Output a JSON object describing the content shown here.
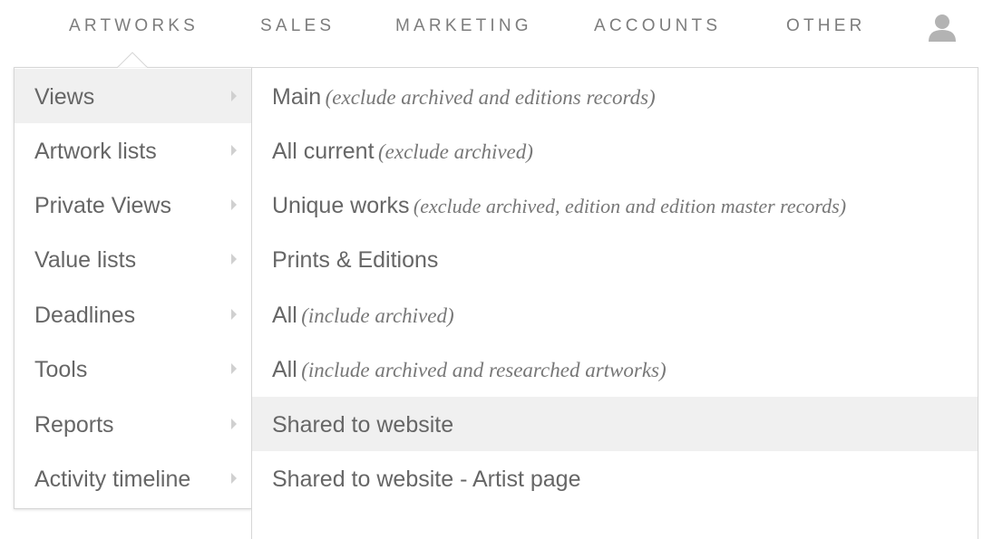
{
  "nav": {
    "items": [
      {
        "label": "ARTWORKS",
        "id": "artworks"
      },
      {
        "label": "SALES",
        "id": "sales"
      },
      {
        "label": "MARKETING",
        "id": "marketing"
      },
      {
        "label": "ACCOUNTS",
        "id": "accounts"
      },
      {
        "label": "OTHER",
        "id": "other"
      }
    ],
    "active": "ARTWORKS",
    "avatar_icon": "user-icon"
  },
  "menu": {
    "categories": [
      {
        "label": "Views",
        "active": true
      },
      {
        "label": "Artwork lists"
      },
      {
        "label": "Private Views"
      },
      {
        "label": "Value lists"
      },
      {
        "label": "Deadlines"
      },
      {
        "label": "Tools"
      },
      {
        "label": "Reports"
      },
      {
        "label": "Activity timeline"
      }
    ],
    "submenu": [
      {
        "label": "Main",
        "note": "(exclude archived and editions records)"
      },
      {
        "label": "All current",
        "note": "(exclude archived)"
      },
      {
        "label": "Unique works",
        "note": "(exclude archived, edition and edition master records)"
      },
      {
        "label": "Prints & Editions",
        "note": ""
      },
      {
        "label": "All",
        "note": "(include archived)"
      },
      {
        "label": "All",
        "note": "(include archived and researched artworks)"
      },
      {
        "label": "Shared to website",
        "note": "",
        "hover": true
      },
      {
        "label": "Shared to website - Artist page",
        "note": ""
      }
    ]
  },
  "colors": {
    "highlight_bg": "#f0f0f0",
    "border": "#d6d6d6",
    "nav_text": "#7d7d7d"
  }
}
